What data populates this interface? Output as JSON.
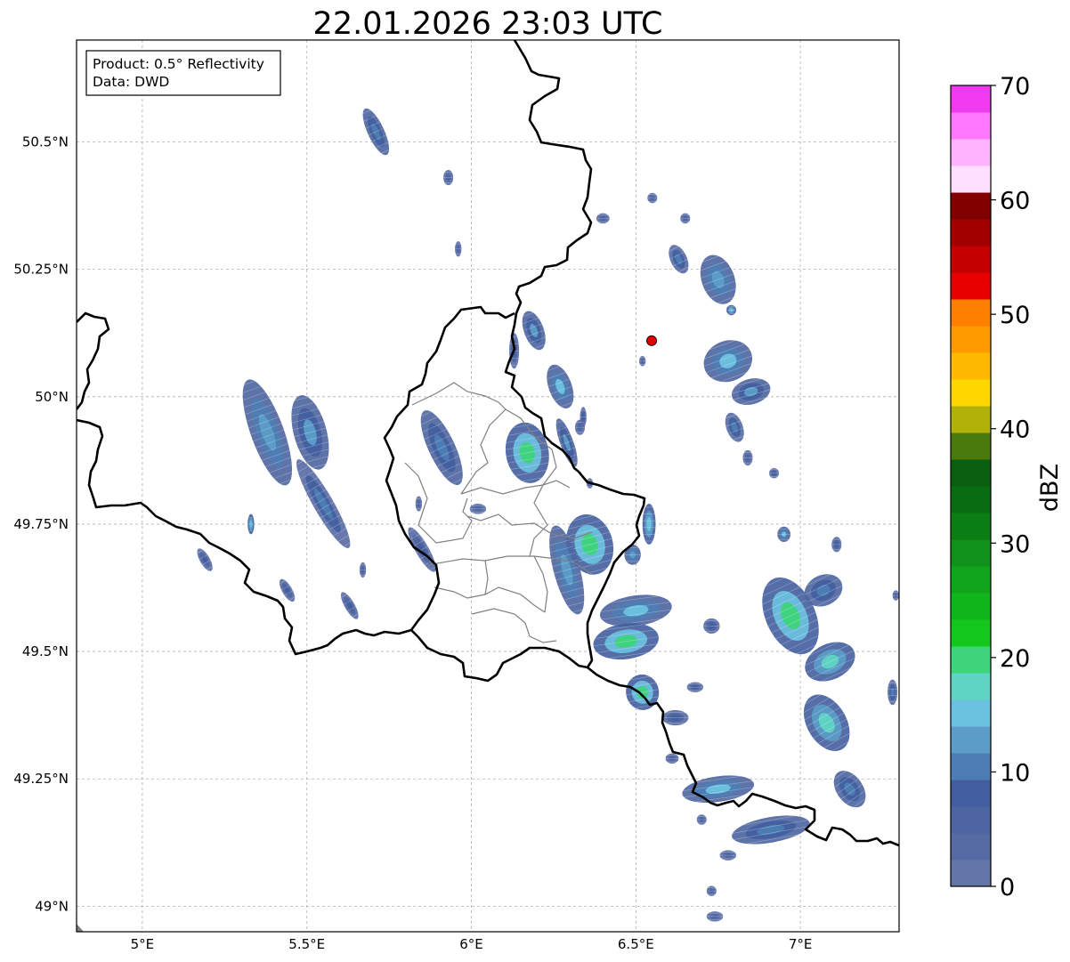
{
  "title": "22.01.2026 23:03 UTC",
  "info_box": {
    "line1": "Product: 0.5° Reflectivity",
    "line2": "Data: DWD"
  },
  "map": {
    "lon_range": [
      4.8,
      7.3
    ],
    "lat_range": [
      48.95,
      50.7
    ],
    "x_ticks": [
      {
        "value": 5.0,
        "label": "5°E"
      },
      {
        "value": 5.5,
        "label": "5.5°E"
      },
      {
        "value": 6.0,
        "label": "6°E"
      },
      {
        "value": 6.5,
        "label": "6.5°E"
      },
      {
        "value": 7.0,
        "label": "7°E"
      }
    ],
    "y_ticks": [
      {
        "value": 49.0,
        "label": "49°N"
      },
      {
        "value": 49.25,
        "label": "49.25°N"
      },
      {
        "value": 49.5,
        "label": "49.5°N"
      },
      {
        "value": 49.75,
        "label": "49.75°N"
      },
      {
        "value": 50.0,
        "label": "50°N"
      },
      {
        "value": 50.25,
        "label": "50.25°N"
      },
      {
        "value": 50.5,
        "label": "50.5°N"
      }
    ],
    "gridlines": true,
    "radar_site": {
      "lon": 6.548,
      "lat": 50.11,
      "color": "#e60000"
    },
    "country_border_color": "#000000",
    "region_border_color": "#808080"
  },
  "colorbar": {
    "label": "dBZ",
    "min": 0,
    "max": 70,
    "step": 2.5,
    "ticks": [
      {
        "value": 0,
        "label": "0"
      },
      {
        "value": 10,
        "label": "10"
      },
      {
        "value": 20,
        "label": "20"
      },
      {
        "value": 30,
        "label": "30"
      },
      {
        "value": 40,
        "label": "40"
      },
      {
        "value": 50,
        "label": "50"
      },
      {
        "value": 60,
        "label": "60"
      },
      {
        "value": 70,
        "label": "70"
      }
    ],
    "colors": [
      "#6475a8",
      "#566aa3",
      "#4c649f",
      "#425e9f",
      "#4c7db4",
      "#5b9dc8",
      "#6bc2e0",
      "#5fd4c4",
      "#3ed47a",
      "#13c81b",
      "#10b41b",
      "#10a41a",
      "#0f911a",
      "#0a7e15",
      "#0a6c12",
      "#095e0f",
      "#4a7a0c",
      "#b0b20a",
      "#ffd700",
      "#ffb900",
      "#ff9a00",
      "#ff7f00",
      "#e60000",
      "#c40000",
      "#a20000",
      "#800000",
      "#ffe0ff",
      "#ffb3ff",
      "#ff78ff",
      "#f03af0"
    ]
  },
  "echo_cells": [
    {
      "lon": 5.71,
      "lat": 50.52,
      "w": 0.05,
      "h": 0.1,
      "rot": -25,
      "v": 12
    },
    {
      "lon": 5.93,
      "lat": 50.43,
      "w": 0.03,
      "h": 0.03,
      "rot": 0,
      "v": 6
    },
    {
      "lon": 5.96,
      "lat": 50.29,
      "w": 0.02,
      "h": 0.03,
      "rot": 0,
      "v": 6
    },
    {
      "lon": 5.38,
      "lat": 49.93,
      "w": 0.1,
      "h": 0.22,
      "rot": -20,
      "v": 14
    },
    {
      "lon": 5.51,
      "lat": 49.93,
      "w": 0.1,
      "h": 0.15,
      "rot": -15,
      "v": 13
    },
    {
      "lon": 5.55,
      "lat": 49.79,
      "w": 0.06,
      "h": 0.2,
      "rot": -30,
      "v": 10
    },
    {
      "lon": 5.33,
      "lat": 49.75,
      "w": 0.02,
      "h": 0.04,
      "rot": 0,
      "v": 17
    },
    {
      "lon": 5.19,
      "lat": 49.68,
      "w": 0.03,
      "h": 0.05,
      "rot": -30,
      "v": 8
    },
    {
      "lon": 5.44,
      "lat": 49.62,
      "w": 0.03,
      "h": 0.05,
      "rot": -30,
      "v": 8
    },
    {
      "lon": 5.63,
      "lat": 49.59,
      "w": 0.03,
      "h": 0.06,
      "rot": -30,
      "v": 8
    },
    {
      "lon": 5.67,
      "lat": 49.66,
      "w": 0.02,
      "h": 0.03,
      "rot": 0,
      "v": 6
    },
    {
      "lon": 5.91,
      "lat": 49.9,
      "w": 0.08,
      "h": 0.16,
      "rot": -25,
      "v": 12
    },
    {
      "lon": 5.85,
      "lat": 49.7,
      "w": 0.04,
      "h": 0.1,
      "rot": -30,
      "v": 8
    },
    {
      "lon": 5.84,
      "lat": 49.79,
      "w": 0.02,
      "h": 0.03,
      "rot": 0,
      "v": 6
    },
    {
      "lon": 6.02,
      "lat": 49.78,
      "w": 0.05,
      "h": 0.02,
      "rot": 0,
      "v": 6
    },
    {
      "lon": 6.19,
      "lat": 50.13,
      "w": 0.06,
      "h": 0.08,
      "rot": -20,
      "v": 13
    },
    {
      "lon": 6.13,
      "lat": 50.09,
      "w": 0.03,
      "h": 0.07,
      "rot": 0,
      "v": 8
    },
    {
      "lon": 6.27,
      "lat": 50.02,
      "w": 0.07,
      "h": 0.09,
      "rot": -20,
      "v": 16
    },
    {
      "lon": 6.17,
      "lat": 49.89,
      "w": 0.13,
      "h": 0.12,
      "rot": -10,
      "v": 22
    },
    {
      "lon": 6.29,
      "lat": 49.91,
      "w": 0.04,
      "h": 0.1,
      "rot": -20,
      "v": 13
    },
    {
      "lon": 6.34,
      "lat": 49.96,
      "w": 0.02,
      "h": 0.04,
      "rot": 0,
      "v": 8
    },
    {
      "lon": 6.36,
      "lat": 49.71,
      "w": 0.14,
      "h": 0.12,
      "rot": -15,
      "v": 22
    },
    {
      "lon": 6.29,
      "lat": 49.66,
      "w": 0.08,
      "h": 0.18,
      "rot": -15,
      "v": 14
    },
    {
      "lon": 6.49,
      "lat": 49.69,
      "w": 0.05,
      "h": 0.04,
      "rot": 0,
      "v": 14
    },
    {
      "lon": 6.5,
      "lat": 49.58,
      "w": 0.22,
      "h": 0.06,
      "rot": -8,
      "v": 15
    },
    {
      "lon": 6.47,
      "lat": 49.52,
      "w": 0.2,
      "h": 0.07,
      "rot": -8,
      "v": 21
    },
    {
      "lon": 6.54,
      "lat": 49.75,
      "w": 0.04,
      "h": 0.08,
      "rot": 0,
      "v": 17
    },
    {
      "lon": 6.52,
      "lat": 49.42,
      "w": 0.1,
      "h": 0.07,
      "rot": -10,
      "v": 22
    },
    {
      "lon": 6.62,
      "lat": 49.37,
      "w": 0.08,
      "h": 0.03,
      "rot": 0,
      "v": 8
    },
    {
      "lon": 6.61,
      "lat": 49.29,
      "w": 0.04,
      "h": 0.02,
      "rot": 0,
      "v": 6
    },
    {
      "lon": 6.75,
      "lat": 49.23,
      "w": 0.22,
      "h": 0.05,
      "rot": -8,
      "v": 16
    },
    {
      "lon": 6.91,
      "lat": 49.15,
      "w": 0.24,
      "h": 0.05,
      "rot": -10,
      "v": 12
    },
    {
      "lon": 6.7,
      "lat": 49.17,
      "w": 0.03,
      "h": 0.02,
      "rot": 0,
      "v": 6
    },
    {
      "lon": 6.78,
      "lat": 49.1,
      "w": 0.05,
      "h": 0.02,
      "rot": 0,
      "v": 6
    },
    {
      "lon": 6.73,
      "lat": 49.03,
      "w": 0.03,
      "h": 0.02,
      "rot": 0,
      "v": 6
    },
    {
      "lon": 6.74,
      "lat": 48.98,
      "w": 0.05,
      "h": 0.02,
      "rot": 0,
      "v": 6
    },
    {
      "lon": 6.97,
      "lat": 49.57,
      "w": 0.15,
      "h": 0.16,
      "rot": -25,
      "v": 22
    },
    {
      "lon": 7.07,
      "lat": 49.62,
      "w": 0.12,
      "h": 0.06,
      "rot": -25,
      "v": 12
    },
    {
      "lon": 7.09,
      "lat": 49.48,
      "w": 0.16,
      "h": 0.07,
      "rot": -25,
      "v": 18
    },
    {
      "lon": 7.08,
      "lat": 49.36,
      "w": 0.12,
      "h": 0.12,
      "rot": -30,
      "v": 19
    },
    {
      "lon": 7.15,
      "lat": 49.23,
      "w": 0.08,
      "h": 0.08,
      "rot": -35,
      "v": 12
    },
    {
      "lon": 6.95,
      "lat": 49.73,
      "w": 0.04,
      "h": 0.03,
      "rot": 0,
      "v": 16
    },
    {
      "lon": 7.11,
      "lat": 49.71,
      "w": 0.03,
      "h": 0.03,
      "rot": 0,
      "v": 8
    },
    {
      "lon": 7.28,
      "lat": 49.42,
      "w": 0.03,
      "h": 0.05,
      "rot": 0,
      "v": 10
    },
    {
      "lon": 7.29,
      "lat": 49.61,
      "w": 0.02,
      "h": 0.02,
      "rot": 0,
      "v": 6
    },
    {
      "lon": 6.75,
      "lat": 50.23,
      "w": 0.1,
      "h": 0.1,
      "rot": -20,
      "v": 14
    },
    {
      "lon": 6.63,
      "lat": 50.27,
      "w": 0.05,
      "h": 0.06,
      "rot": -25,
      "v": 10
    },
    {
      "lon": 6.65,
      "lat": 50.35,
      "w": 0.03,
      "h": 0.02,
      "rot": 0,
      "v": 6
    },
    {
      "lon": 6.55,
      "lat": 50.39,
      "w": 0.03,
      "h": 0.02,
      "rot": 0,
      "v": 6
    },
    {
      "lon": 6.4,
      "lat": 50.35,
      "w": 0.04,
      "h": 0.02,
      "rot": 0,
      "v": 6
    },
    {
      "lon": 6.79,
      "lat": 50.17,
      "w": 0.03,
      "h": 0.02,
      "rot": 0,
      "v": 17
    },
    {
      "lon": 6.78,
      "lat": 50.07,
      "w": 0.15,
      "h": 0.08,
      "rot": -20,
      "v": 15
    },
    {
      "lon": 6.85,
      "lat": 50.01,
      "w": 0.12,
      "h": 0.05,
      "rot": -15,
      "v": 13
    },
    {
      "lon": 6.8,
      "lat": 49.94,
      "w": 0.05,
      "h": 0.06,
      "rot": -20,
      "v": 10
    },
    {
      "lon": 6.84,
      "lat": 49.88,
      "w": 0.03,
      "h": 0.03,
      "rot": 0,
      "v": 6
    },
    {
      "lon": 6.92,
      "lat": 49.85,
      "w": 0.03,
      "h": 0.02,
      "rot": 0,
      "v": 8
    },
    {
      "lon": 6.52,
      "lat": 50.07,
      "w": 0.02,
      "h": 0.02,
      "rot": 0,
      "v": 6
    },
    {
      "lon": 6.33,
      "lat": 49.94,
      "w": 0.03,
      "h": 0.03,
      "rot": 0,
      "v": 6
    },
    {
      "lon": 6.36,
      "lat": 49.83,
      "w": 0.02,
      "h": 0.02,
      "rot": 0,
      "v": 6
    },
    {
      "lon": 6.68,
      "lat": 49.43,
      "w": 0.05,
      "h": 0.02,
      "rot": 0,
      "v": 8
    },
    {
      "lon": 6.73,
      "lat": 49.55,
      "w": 0.05,
      "h": 0.03,
      "rot": 0,
      "v": 8
    }
  ]
}
